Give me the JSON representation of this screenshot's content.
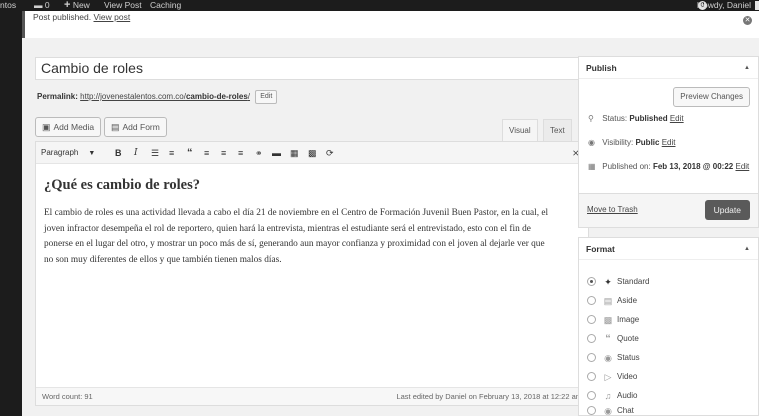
{
  "admin_bar": {
    "site_fragment": "ntos",
    "comments_count": "0",
    "new_label": "New",
    "view_post_label": "View Post",
    "caching_label": "Caching",
    "avatar_letter": "0",
    "howdy": "Howdy, Daniel"
  },
  "notice": {
    "text": "Post published.",
    "link": "View post"
  },
  "post": {
    "title": "Cambio de roles",
    "permalink_label": "Permalink:",
    "permalink_base": "http://jovenestalentos.com.co/",
    "permalink_slug": "cambio-de-roles",
    "permalink_tail": "/",
    "permalink_edit": "Edit"
  },
  "media_buttons": {
    "add_media": "Add Media",
    "add_form": "Add Form"
  },
  "editor_tabs": {
    "visual": "Visual",
    "text": "Text"
  },
  "toolbar": {
    "format_select": "Paragraph",
    "icons": [
      "bold-icon",
      "italic-icon",
      "bullet-list-icon",
      "numbered-list-icon",
      "blockquote-icon",
      "align-left-icon",
      "align-center-icon",
      "align-right-icon",
      "link-icon",
      "horizontal-rule-icon",
      "toolbar-toggle-icon",
      "insert-media-icon",
      "refresh-icon",
      "fullscreen-icon"
    ]
  },
  "content": {
    "heading": "¿Qué es cambio de roles?",
    "paragraph": "El cambio de roles es una actividad llevada a cabo el día 21 de noviembre en el Centro de Formación Juvenil Buen Pastor, en la cual, el joven infractor desempeña el rol de reportero, quien hará la entrevista, mientras el estudiante será el entrevistado, esto con el fin de ponerse en el lugar del otro, y mostrar un poco más de sí, generando aun mayor confianza y proximidad con el joven al dejarle ver que no son muy diferentes de ellos y que también tienen malos días."
  },
  "status_bar": {
    "word_count": "Word count: 91",
    "last_edited": "Last edited by Daniel on February 13, 2018 at 12:22 am"
  },
  "publish": {
    "title": "Publish",
    "preview_button": "Preview Changes",
    "status_label": "Status:",
    "status_value": "Published",
    "status_edit": "Edit",
    "visibility_label": "Visibility:",
    "visibility_value": "Public",
    "visibility_edit": "Edit",
    "published_label": "Published on:",
    "published_value": "Feb 13, 2018 @ 00:22",
    "published_edit": "Edit",
    "trash_link": "Move to Trash",
    "update_button": "Update"
  },
  "format": {
    "title": "Format",
    "selected": "Standard",
    "options": [
      {
        "label": "Standard",
        "icon": "pin-icon"
      },
      {
        "label": "Aside",
        "icon": "aside-icon"
      },
      {
        "label": "Image",
        "icon": "image-icon"
      },
      {
        "label": "Quote",
        "icon": "quote-icon"
      },
      {
        "label": "Status",
        "icon": "status-bubble-icon"
      },
      {
        "label": "Video",
        "icon": "video-icon"
      },
      {
        "label": "Audio",
        "icon": "audio-icon"
      },
      {
        "label": "Chat",
        "icon": "chat-icon"
      }
    ]
  },
  "colors": {
    "admin_bar_bg": "#1c1c1c",
    "canvas_bg": "#f1f1f1",
    "update_button_bg": "#5a5a5a"
  }
}
